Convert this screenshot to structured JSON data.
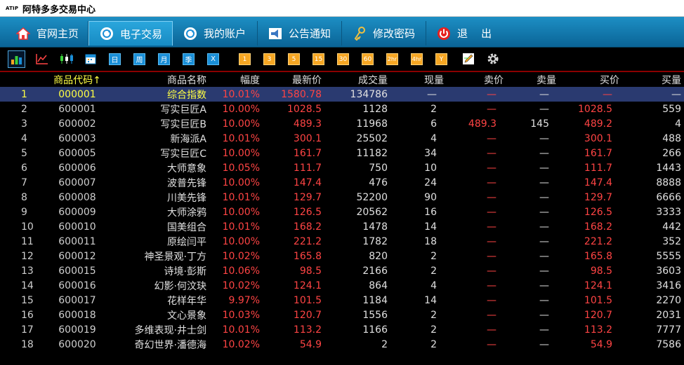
{
  "app": {
    "logo": "ATIP",
    "title": "阿特多多交易中心"
  },
  "nav": [
    {
      "label": "官网主页",
      "icon": "home-icon"
    },
    {
      "label": "电子交易",
      "icon": "refresh-icon"
    },
    {
      "label": "我的账户",
      "icon": "refresh-icon"
    },
    {
      "label": "公告通知",
      "icon": "megaphone-icon"
    },
    {
      "label": "修改密码",
      "icon": "key-icon"
    },
    {
      "label": "退    出",
      "icon": "power-icon"
    }
  ],
  "toolbar": {
    "blue": [
      "日",
      "周",
      "月",
      "季",
      "X"
    ],
    "orange": [
      "1",
      "3",
      "5",
      "15",
      "30",
      "60",
      "2hr",
      "4hr",
      "Y"
    ]
  },
  "columns": {
    "code": "商品代码↑",
    "name": "商品名称",
    "change": "幅度",
    "last": "最新价",
    "volume": "成交量",
    "cur": "现量",
    "ask": "卖价",
    "askvol": "卖量",
    "bid": "买价",
    "bidvol": "买量"
  },
  "rows": [
    {
      "idx": "1",
      "code": "000001",
      "name": "综合指数",
      "change": "10.01%",
      "last": "1580.78",
      "volume": "134786",
      "cur": "—",
      "ask": "—",
      "askvol": "—",
      "bid": "—",
      "bidvol": "—"
    },
    {
      "idx": "2",
      "code": "600001",
      "name": "写实巨匠A",
      "change": "10.00%",
      "last": "1028.5",
      "volume": "1128",
      "cur": "2",
      "ask": "—",
      "askvol": "—",
      "bid": "1028.5",
      "bidvol": "559"
    },
    {
      "idx": "3",
      "code": "600002",
      "name": "写实巨匠B",
      "change": "10.00%",
      "last": "489.3",
      "volume": "11968",
      "cur": "6",
      "ask": "489.3",
      "askvol": "145",
      "bid": "489.2",
      "bidvol": "4"
    },
    {
      "idx": "4",
      "code": "600003",
      "name": "新海派A",
      "change": "10.01%",
      "last": "300.1",
      "volume": "25502",
      "cur": "4",
      "ask": "—",
      "askvol": "—",
      "bid": "300.1",
      "bidvol": "488"
    },
    {
      "idx": "5",
      "code": "600005",
      "name": "写实巨匠C",
      "change": "10.00%",
      "last": "161.7",
      "volume": "11182",
      "cur": "34",
      "ask": "—",
      "askvol": "—",
      "bid": "161.7",
      "bidvol": "266"
    },
    {
      "idx": "6",
      "code": "600006",
      "name": "大师意象",
      "change": "10.05%",
      "last": "111.7",
      "volume": "750",
      "cur": "10",
      "ask": "—",
      "askvol": "—",
      "bid": "111.7",
      "bidvol": "1443"
    },
    {
      "idx": "7",
      "code": "600007",
      "name": "波普先锋",
      "change": "10.00%",
      "last": "147.4",
      "volume": "476",
      "cur": "24",
      "ask": "—",
      "askvol": "—",
      "bid": "147.4",
      "bidvol": "8888"
    },
    {
      "idx": "8",
      "code": "600008",
      "name": "川美先锋",
      "change": "10.01%",
      "last": "129.7",
      "volume": "52200",
      "cur": "90",
      "ask": "—",
      "askvol": "—",
      "bid": "129.7",
      "bidvol": "6666"
    },
    {
      "idx": "9",
      "code": "600009",
      "name": "大师涂鸦",
      "change": "10.00%",
      "last": "126.5",
      "volume": "20562",
      "cur": "16",
      "ask": "—",
      "askvol": "—",
      "bid": "126.5",
      "bidvol": "3333"
    },
    {
      "idx": "10",
      "code": "600010",
      "name": "国美组合",
      "change": "10.01%",
      "last": "168.2",
      "volume": "1478",
      "cur": "14",
      "ask": "—",
      "askvol": "—",
      "bid": "168.2",
      "bidvol": "442"
    },
    {
      "idx": "11",
      "code": "600011",
      "name": "原绘闫平",
      "change": "10.00%",
      "last": "221.2",
      "volume": "1782",
      "cur": "18",
      "ask": "—",
      "askvol": "—",
      "bid": "221.2",
      "bidvol": "352"
    },
    {
      "idx": "12",
      "code": "600012",
      "name": "神圣景观·丁方",
      "change": "10.02%",
      "last": "165.8",
      "volume": "820",
      "cur": "2",
      "ask": "—",
      "askvol": "—",
      "bid": "165.8",
      "bidvol": "5555"
    },
    {
      "idx": "13",
      "code": "600015",
      "name": "诗境·彭斯",
      "change": "10.06%",
      "last": "98.5",
      "volume": "2166",
      "cur": "2",
      "ask": "—",
      "askvol": "—",
      "bid": "98.5",
      "bidvol": "3603"
    },
    {
      "idx": "14",
      "code": "600016",
      "name": "幻影·何汶玦",
      "change": "10.02%",
      "last": "124.1",
      "volume": "864",
      "cur": "4",
      "ask": "—",
      "askvol": "—",
      "bid": "124.1",
      "bidvol": "3416"
    },
    {
      "idx": "15",
      "code": "600017",
      "name": "花样年华",
      "change": "9.97%",
      "last": "101.5",
      "volume": "1184",
      "cur": "14",
      "ask": "—",
      "askvol": "—",
      "bid": "101.5",
      "bidvol": "2270"
    },
    {
      "idx": "16",
      "code": "600018",
      "name": "文心景象",
      "change": "10.03%",
      "last": "120.7",
      "volume": "1556",
      "cur": "2",
      "ask": "—",
      "askvol": "—",
      "bid": "120.7",
      "bidvol": "2031"
    },
    {
      "idx": "17",
      "code": "600019",
      "name": "多维表现·井士剑",
      "change": "10.01%",
      "last": "113.2",
      "volume": "1166",
      "cur": "2",
      "ask": "—",
      "askvol": "—",
      "bid": "113.2",
      "bidvol": "7777"
    },
    {
      "idx": "18",
      "code": "600020",
      "name": "奇幻世界·潘德海",
      "change": "10.02%",
      "last": "54.9",
      "volume": "2",
      "cur": "2",
      "ask": "—",
      "askvol": "—",
      "bid": "54.9",
      "bidvol": "7586"
    }
  ]
}
